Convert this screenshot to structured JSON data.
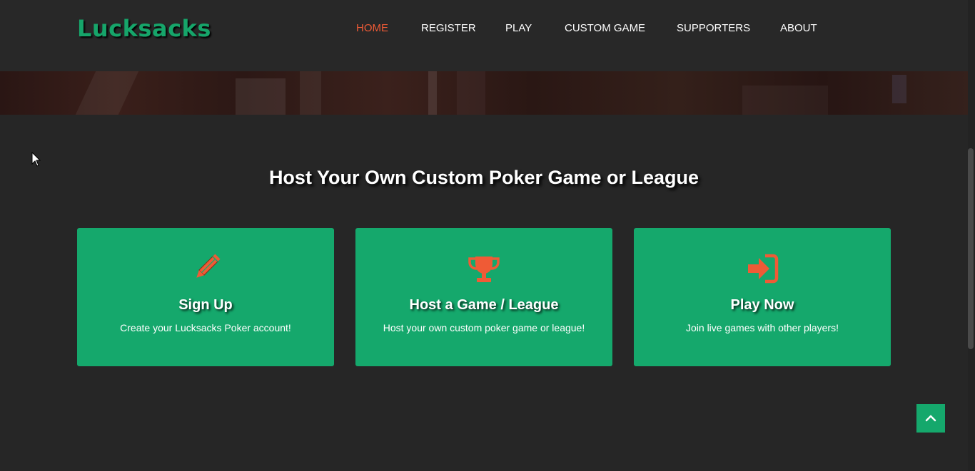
{
  "header": {
    "logo": "Lucksacks",
    "nav": [
      {
        "label": "HOME",
        "active": true
      },
      {
        "label": "REGISTER",
        "active": false
      },
      {
        "label": "PLAY",
        "active": false
      },
      {
        "label": "CUSTOM GAME",
        "active": false
      },
      {
        "label": "SUPPORTERS",
        "active": false
      },
      {
        "label": "ABOUT",
        "active": false
      }
    ]
  },
  "main": {
    "heading": "Host Your Own Custom Poker Game or League",
    "cards": [
      {
        "icon": "pencil-icon",
        "title": "Sign Up",
        "description": "Create your Lucksacks Poker account!"
      },
      {
        "icon": "trophy-icon",
        "title": "Host a Game / League",
        "description": "Host your own custom poker game or league!"
      },
      {
        "icon": "sign-in-icon",
        "title": "Play Now",
        "description": "Join live games with other players!"
      }
    ]
  },
  "back_to_top": {
    "icon": "chevron-up-icon"
  },
  "colors": {
    "background": "#262626",
    "accent_green": "#15a86c",
    "accent_orange": "#ef5b36",
    "text": "#ffffff"
  }
}
